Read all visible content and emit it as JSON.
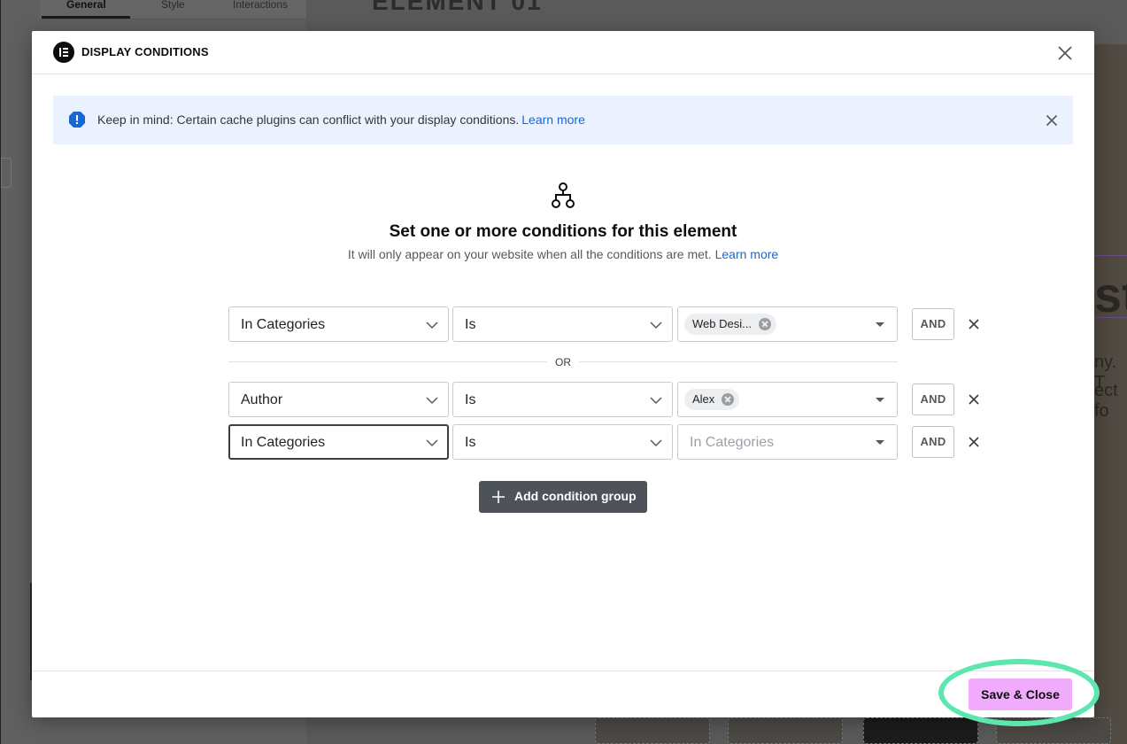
{
  "background": {
    "tabs": [
      "General",
      "Style",
      "Interactions"
    ],
    "canvas_heading": "ELEMENT 01",
    "canvas_big_text": "st",
    "canvas_line1": "ny. T",
    "canvas_line2": "ect fo"
  },
  "modal": {
    "title": "DISPLAY CONDITIONS",
    "logo_icon": "elementor-logo-icon",
    "close_icon": "close-icon"
  },
  "alert": {
    "icon": "info-icon",
    "text": "Keep in mind: Certain cache plugins can conflict with your display conditions.",
    "link": "Learn more",
    "accent_color": "#1967d2",
    "background_color": "#ebf2fd"
  },
  "intro": {
    "icon": "sitemap-icon",
    "heading": "Set one or more conditions for this element",
    "subtext": "It will only appear on your website when all the conditions are met.",
    "link": "Learn more"
  },
  "groups": [
    {
      "rows": [
        {
          "field": "In Categories",
          "operator": "Is",
          "value_chip": "Web Desi...",
          "connector": "AND"
        }
      ]
    },
    {
      "separator": "OR",
      "rows": [
        {
          "field": "Author",
          "operator": "Is",
          "value_chip": "Alex",
          "connector": "AND"
        },
        {
          "field": "In Categories",
          "operator": "Is",
          "value_placeholder": "In Categories",
          "connector": "AND"
        }
      ]
    }
  ],
  "add_group_label": "Add condition group",
  "footer": {
    "save_label": "Save & Close",
    "save_color": "#f0abfc",
    "highlight_color": "#5ee6b0"
  }
}
